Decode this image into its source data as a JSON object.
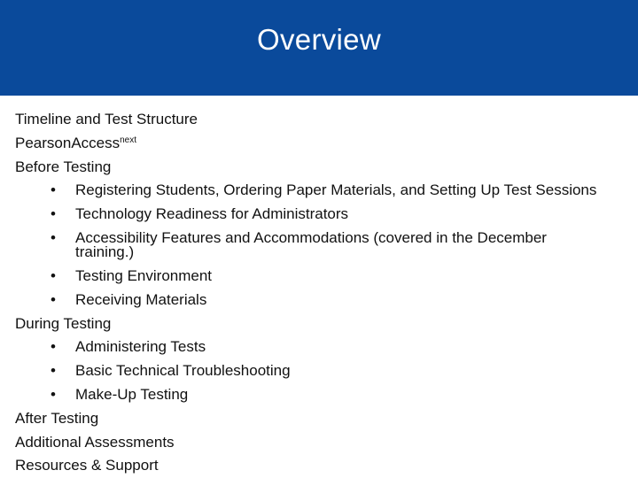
{
  "header": {
    "title": "Overview",
    "background_color": "#0a4a9b"
  },
  "outline": {
    "items": [
      {
        "label": "Timeline and Test Structure"
      },
      {
        "label": "PearsonAccess",
        "superscript": "next"
      },
      {
        "label": "Before Testing"
      },
      {
        "label": "During Testing"
      },
      {
        "label": "After Testing"
      },
      {
        "label": "Additional Assessments"
      },
      {
        "label": "Resources & Support"
      }
    ],
    "before_testing_subitems": [
      "Registering Students, Ordering Paper Materials, and Setting Up Test Sessions",
      "Technology Readiness for Administrators",
      "Accessibility Features and Accommodations (covered in the December training.)",
      "Testing Environment",
      "Receiving Materials"
    ],
    "during_testing_subitems": [
      "Administering Tests",
      "Basic Technical Troubleshooting",
      "Make-Up Testing"
    ],
    "bullet_glyph": "•"
  }
}
